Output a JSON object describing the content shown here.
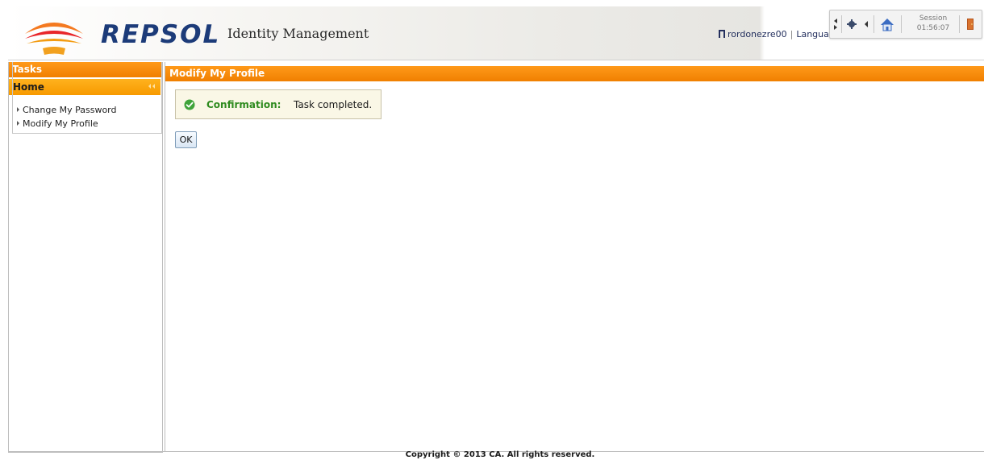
{
  "header": {
    "brand": "REPSOL",
    "app_title": "Identity Management",
    "username": "rordonezre00",
    "separator": "|",
    "language_label": "Language",
    "session_label": "Session",
    "session_time": "01:56:07"
  },
  "left_panel": {
    "tasks_title": "Tasks",
    "home_title": "Home",
    "items": [
      {
        "label": "Change My Password"
      },
      {
        "label": "Modify My Profile"
      }
    ]
  },
  "main": {
    "title": "Modify My Profile",
    "confirmation_label": "Confirmation:",
    "confirmation_text": "Task completed.",
    "ok_label": "OK"
  },
  "footer": {
    "copyright": "Copyright © 2013 CA. All rights reserved."
  },
  "colors": {
    "brand_orange": "#f07f00",
    "brand_navy": "#1c3b79",
    "success_green": "#2f8b1f"
  }
}
